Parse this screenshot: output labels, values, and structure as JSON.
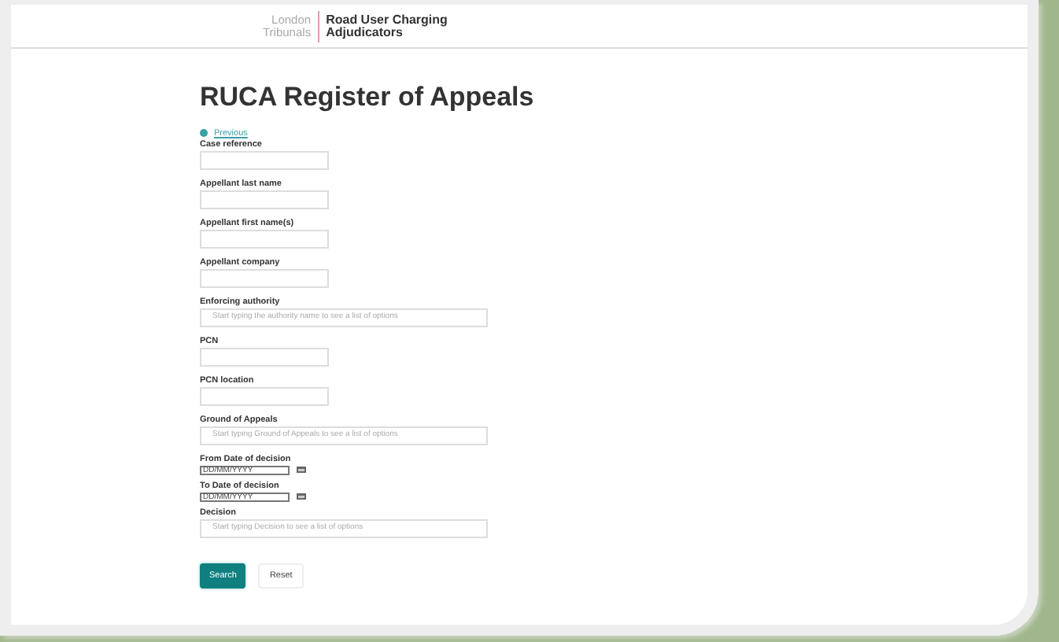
{
  "header": {
    "logo_left": [
      "London",
      "Tribunals"
    ],
    "logo_right": [
      "Road User Charging",
      "Adjudicators"
    ]
  },
  "title": "RUCA Register of Appeals",
  "back_link": "Previous",
  "fields": [
    {
      "kind": "text",
      "label": "Case reference"
    },
    {
      "kind": "text",
      "label": "Appellant last name"
    },
    {
      "kind": "text",
      "label": "Appellant first name(s)"
    },
    {
      "kind": "text",
      "label": "Appellant company"
    },
    {
      "kind": "autocomplete",
      "label": "Enforcing authority",
      "placeholder": "Start typing the authority name to see a list of options"
    },
    {
      "kind": "text",
      "label": "PCN"
    },
    {
      "kind": "text",
      "label": "PCN location"
    },
    {
      "kind": "autocomplete",
      "label": "Ground of Appeals",
      "placeholder": "Start typing Ground of Appeals to see a list of options"
    },
    {
      "kind": "date",
      "label": "From Date of decision",
      "placeholder": "DD/MM/YYYY"
    },
    {
      "kind": "date",
      "label": "To Date of decision",
      "placeholder": "DD/MM/YYYY"
    },
    {
      "kind": "autocomplete",
      "label": "Decision",
      "placeholder": "Start typing Decision to see a list of options"
    }
  ],
  "buttons": [
    {
      "kind": "primary",
      "label": "Search"
    },
    {
      "kind": "secondary",
      "label": "Reset"
    }
  ]
}
